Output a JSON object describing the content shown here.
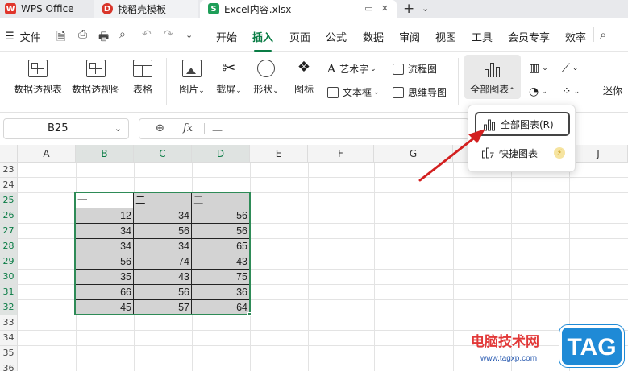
{
  "titlebar": {
    "app_tab": "WPS Office",
    "template_tab": "找稻壳模板",
    "file_tab": "Excel内容.xlsx",
    "new_tab": "+"
  },
  "menu": {
    "file_label": "文件",
    "tabs": [
      "开始",
      "插入",
      "页面",
      "公式",
      "数据",
      "审阅",
      "视图",
      "工具",
      "会员专享",
      "效率"
    ],
    "active_tab": "插入"
  },
  "ribbon": {
    "pivot_table": "数据透视表",
    "pivot_chart": "数据透视图",
    "table": "表格",
    "picture": "图片",
    "screenshot": "截屏",
    "shape": "形状",
    "icon": "图标",
    "art_text": "艺术字",
    "text_box": "文本框",
    "flowchart": "流程图",
    "mind_map": "思维导图",
    "all_charts": "全部图表",
    "mini": "迷你"
  },
  "formula_bar": {
    "cell_ref": "B25",
    "fx": "fx",
    "value": "一"
  },
  "grid": {
    "columns": [
      "A",
      "B",
      "C",
      "D",
      "E",
      "F",
      "G",
      "H",
      "I",
      "J"
    ],
    "rows": [
      "23",
      "24",
      "25",
      "26",
      "27",
      "28",
      "29",
      "30",
      "31",
      "32",
      "33",
      "34",
      "35",
      "36"
    ],
    "table_headers": [
      "一",
      "二",
      "三"
    ],
    "table_values": [
      [
        "12",
        "34",
        "56"
      ],
      [
        "34",
        "56",
        "56"
      ],
      [
        "34",
        "34",
        "65"
      ],
      [
        "56",
        "74",
        "43"
      ],
      [
        "35",
        "43",
        "75"
      ],
      [
        "66",
        "56",
        "36"
      ],
      [
        "45",
        "57",
        "64"
      ]
    ]
  },
  "popup": {
    "all_charts_item": "全部图表(R)",
    "quick_chart_item": "快捷图表"
  },
  "watermark": {
    "site_name": "电脑技术网",
    "url": "www.tagxp.com",
    "tag": "TAG"
  },
  "colors": {
    "accent": "#0a7c45",
    "selection": "#2e8b57",
    "arrow": "#d32020"
  }
}
